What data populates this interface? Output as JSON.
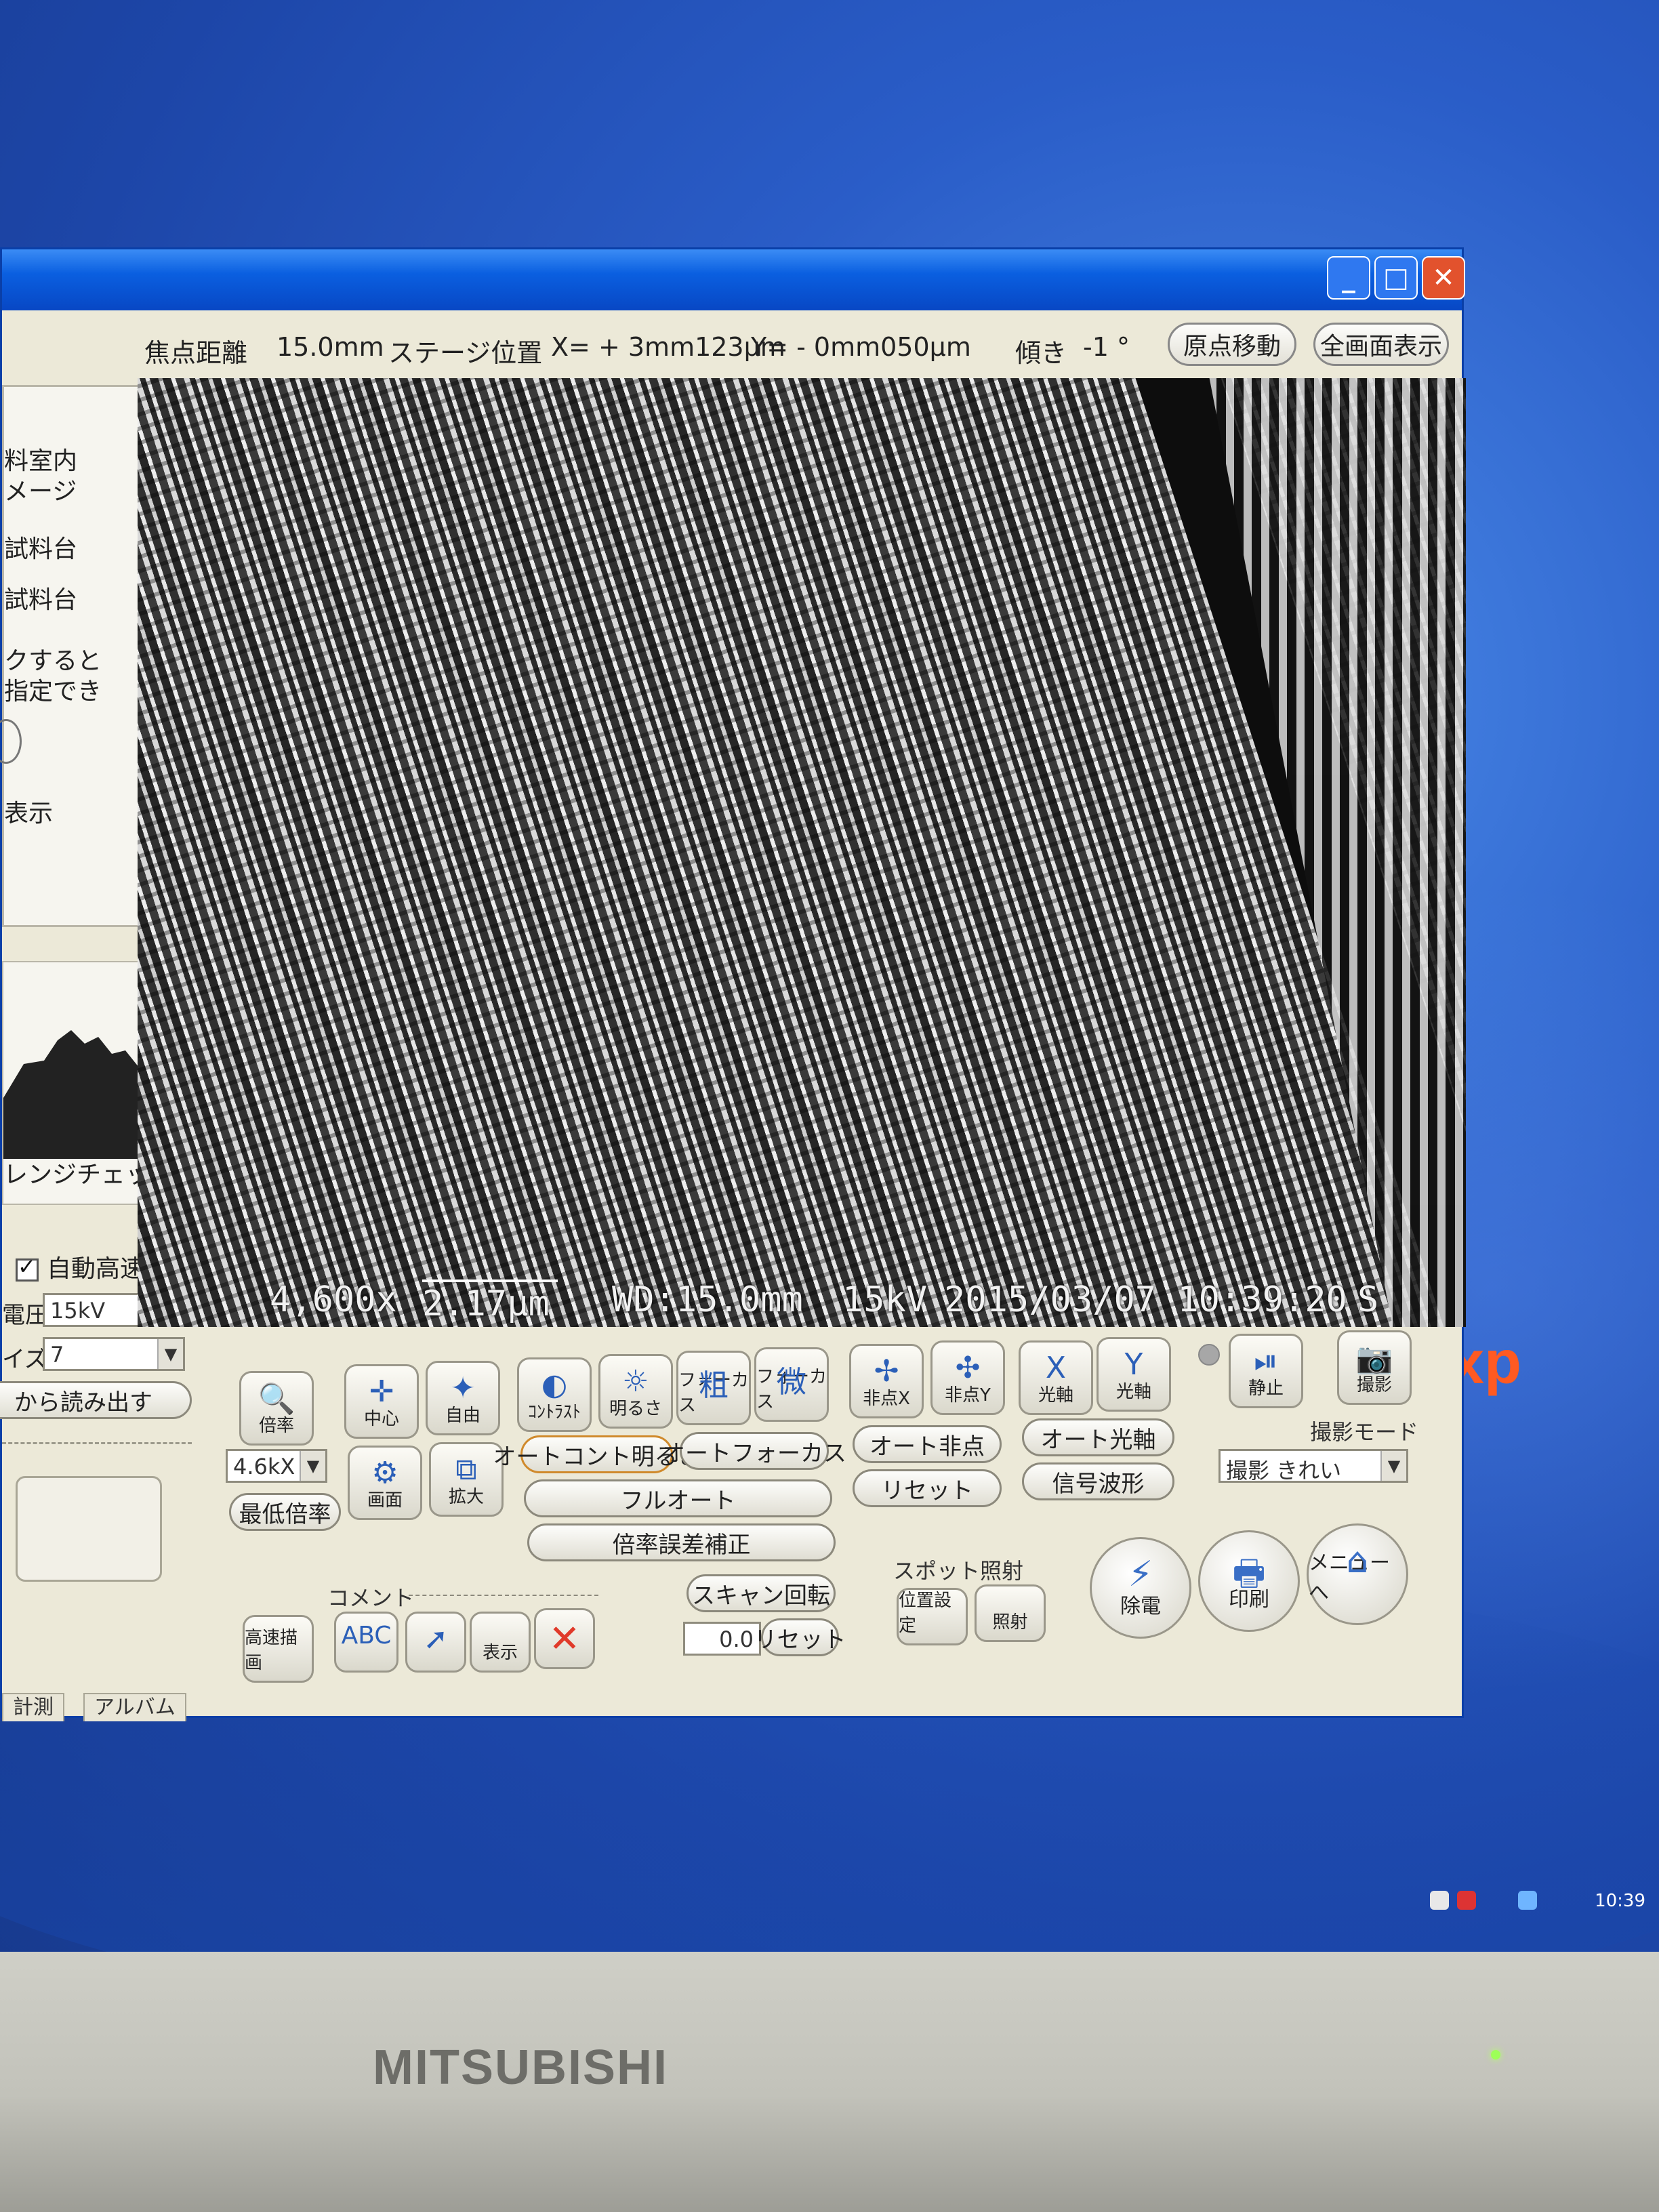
{
  "window": {
    "min_glyph": "_",
    "max_glyph": "□",
    "close_glyph": "✕"
  },
  "infobar": {
    "focal_label": "焦点距離",
    "focal_value": "15.0mm",
    "stage_label": "ステージ位置",
    "x_value": "X= + 3mm123μm",
    "y_value": "Y= - 0mm050μm",
    "tilt_label": "傾き",
    "tilt_value": "-1 °",
    "origin_button": "原点移動",
    "fullscreen_button": "全画面表示"
  },
  "left_panel": {
    "lines": [
      "料室内",
      "メージ",
      "試料台",
      "試料台",
      "クすると",
      "指定でき",
      "表示"
    ],
    "histogram_caption": "レンジチェック",
    "auto_fast_scan": "自動高速描画",
    "voltage_label": "電圧",
    "voltage_value": "15kV",
    "size_label": "イズ",
    "size_value": "7",
    "load_button": "から読み出す"
  },
  "image": {
    "magnification": "4,600x",
    "scale": "2.17μm",
    "wd": "WD:15.0mm",
    "kv": "15kV",
    "datetime": "2015/03/07 10:39:20",
    "mode": "S"
  },
  "controls": {
    "magnify": "倍率",
    "center": "中心",
    "free": "自由",
    "screen": "画面",
    "enlarge": "拡大",
    "mag_select": "4.6kX",
    "min_mag": "最低倍率",
    "contrast": "ｺﾝﾄﾗｽﾄ",
    "brightness": "明るさ",
    "coarse_focus": "フォーカス",
    "coarse_glyph": "粗",
    "fine_focus": "フォーカス",
    "fine_glyph": "微",
    "auto_contrast_brightness": "オートコント明るさ",
    "auto_focus": "オートフォーカス",
    "full_auto": "フルオート",
    "mag_error_correct": "倍率誤差補正",
    "stigma_x": "非点X",
    "stigma_y": "非点Y",
    "auto_stigma": "オート非点",
    "reset": "リセット",
    "axis_x": "光軸",
    "axis_y": "光軸",
    "axis_x_glyph": "X",
    "axis_y_glyph": "Y",
    "auto_axis": "オート光軸",
    "signal_waveform": "信号波形",
    "freeze": "静止",
    "capture": "撮影",
    "capture_mode_label": "撮影モード",
    "capture_mode_value": "撮影 きれい",
    "comment_label": "コメント",
    "fast_scan": "高速描画",
    "abc": "ABC",
    "show": "表示",
    "scan_rotate": "スキャン回転",
    "rotate_value": "0.0",
    "rotate_reset": "リセット",
    "spot_label": "スポット照射",
    "position_set": "位置設定",
    "irradiate": "照射",
    "discharge": "除電",
    "print": "印刷",
    "menu": "メニューへ"
  },
  "tabs": [
    "計測",
    "アルバム"
  ],
  "desktop": {
    "xp_mark": "xp",
    "clock": "10:39",
    "monitor_brand": "MITSUBISHI"
  },
  "colors": {
    "titlebar": "#0a5fe0",
    "window_bg": "#ece9d8",
    "close_button": "#e2522d",
    "desktop": "#2a5dc8"
  }
}
